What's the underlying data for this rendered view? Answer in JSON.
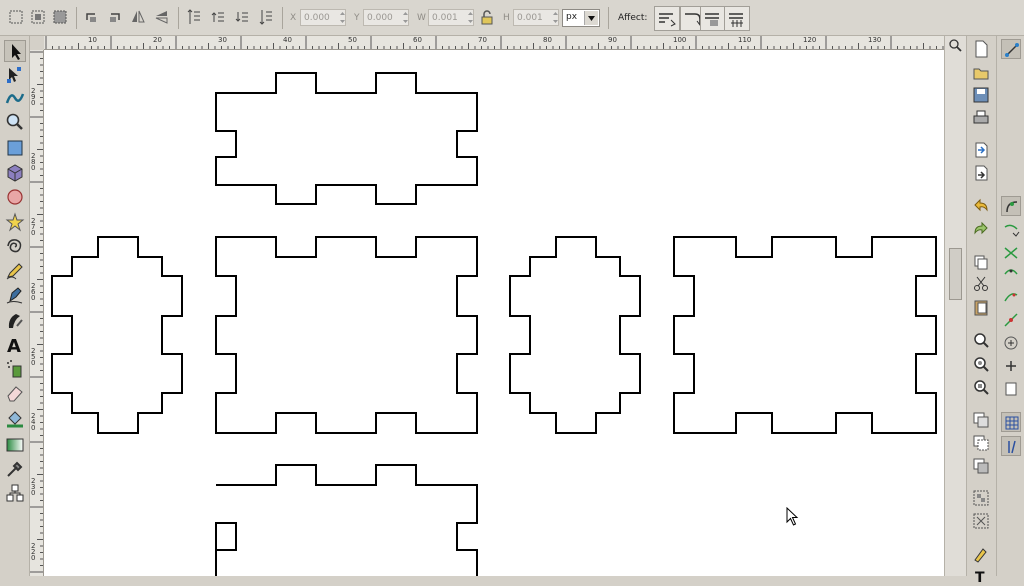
{
  "toolbar": {
    "x_label": "X",
    "x_value": "0.000",
    "y_label": "Y",
    "y_value": "0.000",
    "w_label": "W",
    "w_value": "0.001",
    "h_label": "H",
    "h_value": "0.001",
    "unit": "px",
    "affect_label": "Affect:"
  },
  "ruler": {
    "h_labels": [
      "10",
      "20",
      "30",
      "40",
      "50",
      "60",
      "70",
      "80",
      "90",
      "100",
      "110",
      "120",
      "130"
    ],
    "v_labels": [
      "290",
      "280",
      "270",
      "260",
      "250",
      "240",
      "230",
      "220",
      "210"
    ]
  },
  "tools": [
    "selector-arrow-icon",
    "node-edit-icon",
    "tweak-icon",
    "zoom-icon",
    "rectangle-icon",
    "box3d-icon",
    "ellipse-icon",
    "star-icon",
    "spiral-icon",
    "pencil-icon",
    "pen-icon",
    "calligraphy-icon",
    "text-icon",
    "spray-icon",
    "eraser-icon",
    "paint-bucket-icon",
    "gradient-icon",
    "dropper-icon",
    "connector-icon"
  ],
  "colors": {
    "canvas": "#ffffff",
    "chrome": "#d4d0c8",
    "stroke": "#000000"
  }
}
